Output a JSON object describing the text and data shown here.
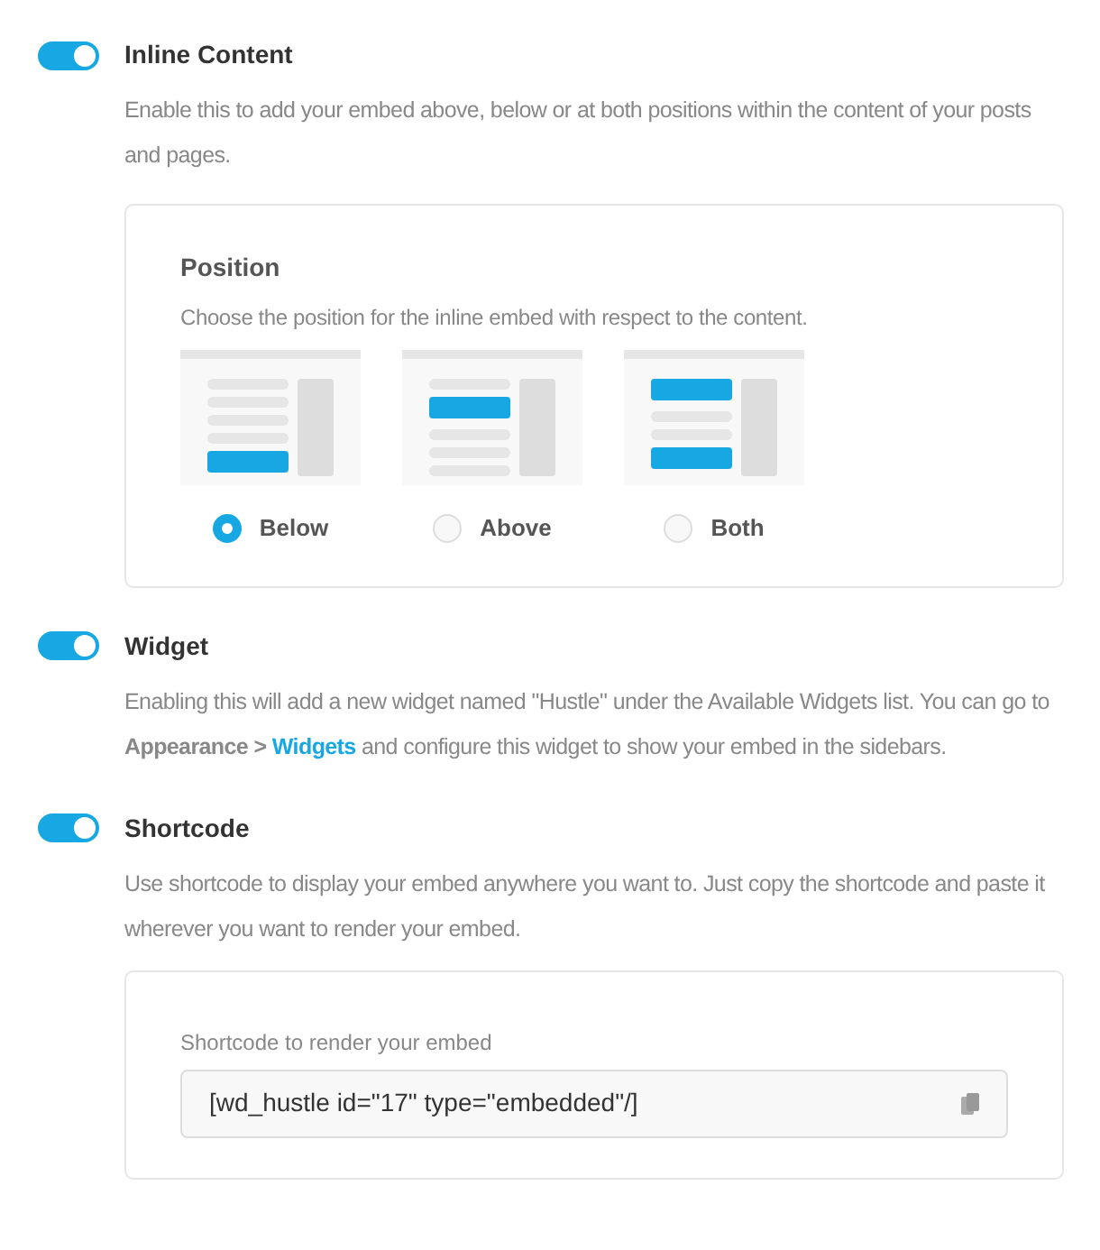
{
  "sections": [
    {
      "title": "Inline Content",
      "on": true,
      "description": [
        {
          "kind": "text",
          "text": "Enable this to add your embed above, below or at both positions within the content of your posts and pages."
        }
      ],
      "panel": {
        "kind": "position",
        "title": "Position",
        "hint": "Choose the position for the inline embed with respect to the content.",
        "options": [
          {
            "kind": "below",
            "label": "Below",
            "selected": true
          },
          {
            "kind": "above",
            "label": "Above",
            "selected": false
          },
          {
            "kind": "both",
            "label": "Both",
            "selected": false
          }
        ]
      }
    },
    {
      "title": "Widget",
      "on": true,
      "description": [
        {
          "kind": "text",
          "text": "Enabling this will add a new widget named \"Hustle\" under the Available Widgets list. You can go to **Appearance >** "
        },
        {
          "kind": "link",
          "text": "Widgets"
        },
        {
          "kind": "text",
          "text": " and configure this widget to show your embed in the sidebars."
        }
      ]
    },
    {
      "title": "Shortcode",
      "on": true,
      "description": [
        {
          "kind": "text",
          "text": "Use shortcode to display your embed anywhere you want to. Just copy the shortcode and paste it wherever you want to render your embed."
        }
      ],
      "panel": {
        "kind": "shortcode",
        "label": "Shortcode to render your embed",
        "value": "[wd_hustle id=\"17\" type=\"embedded\"/]"
      }
    }
  ]
}
